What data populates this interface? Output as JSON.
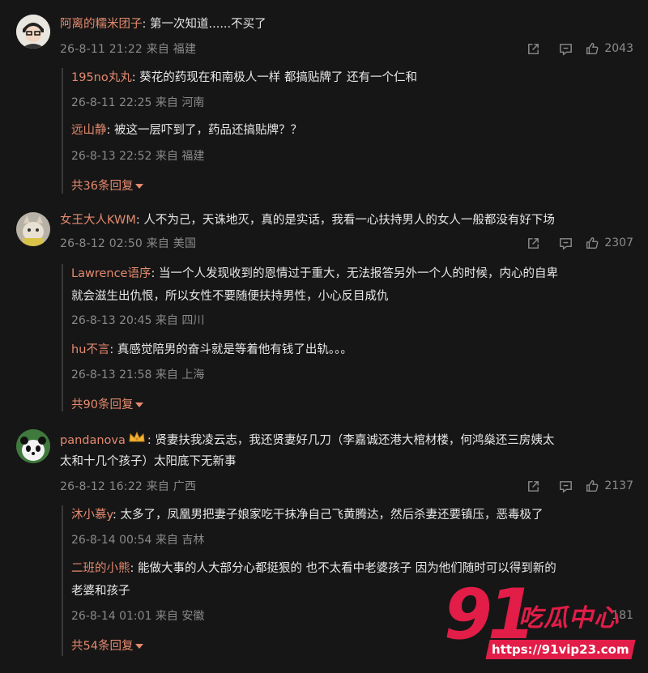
{
  "comments": [
    {
      "user": "阿离的糯米团子",
      "text": ": 第一次知道......不买了",
      "date": "26-8-11 21:22",
      "location": "来自 福建",
      "likes": "2043",
      "replies": [
        {
          "user": "195no丸丸",
          "text": ": 葵花的药现在和南极人一样 都搞贴牌了 还有一个仁和",
          "date": "26-8-11 22:25",
          "location": "来自 河南"
        },
        {
          "user": "远山静",
          "text": ": 被这一层吓到了，药品还搞贴牌？？",
          "date": "26-8-13 22:52",
          "location": "来自 福建"
        }
      ],
      "more": "共36条回复"
    },
    {
      "user": "女王大人KWM",
      "text": ": 人不为己，天诛地灭，真的是实话，我看一心扶持男人的女人一般都没有好下场",
      "date": "26-8-12 02:50",
      "location": "来自 美国",
      "likes": "2307",
      "replies": [
        {
          "user": "Lawrence语序",
          "text": ": 当一个人发现收到的恩情过于重大，无法报答另外一个人的时候，内心的自卑",
          "text2": "就会滋生出仇恨，所以女性不要随便扶持男性，小心反目成仇",
          "date": "26-8-13 20:45",
          "location": "来自 四川"
        },
        {
          "user": "hu不言",
          "text": ": 真感觉陪男的奋斗就是等着他有钱了出轨。。。",
          "date": "26-8-13 21:58",
          "location": "来自 上海"
        }
      ],
      "more": "共90条回复"
    },
    {
      "user": "pandanova",
      "text": ": 贤妻扶我凌云志，我还贤妻好几刀（李嘉诚还港大棺材楼，何鸿燊还三房姨太",
      "text2": "太和十几个孩子）太阳底下无新事",
      "date": "26-8-12 16:22",
      "location": "来自 广西",
      "likes": "2137",
      "replies": [
        {
          "user": "沐小慕y",
          "text": ": 太多了，凤凰男把妻子娘家吃干抹净自己飞黄腾达，然后杀妻还要镇压，恶毒极了",
          "date": "26-8-14 00:54",
          "location": "来自 吉林"
        },
        {
          "user": "二班的小熊",
          "text": ": 能做大事的人大部分心都挺狠的 也不太看中老婆孩子 因为他们随时可以得到新的",
          "text2": "老婆和孩子",
          "date": "26-8-14 01:01",
          "location": "来自 安徽",
          "likes": "181"
        }
      ],
      "more": "共54条回复"
    }
  ],
  "icons": {
    "share": "share-icon",
    "comment": "comment-icon",
    "like": "like-icon"
  },
  "watermark": {
    "number": "91",
    "label": "吃瓜中心",
    "url": "https://91vip23.com"
  },
  "colors": {
    "background": "#161616",
    "username": "#e58a6f",
    "meta": "#8a8a8a",
    "watermark": "#e11d48"
  }
}
